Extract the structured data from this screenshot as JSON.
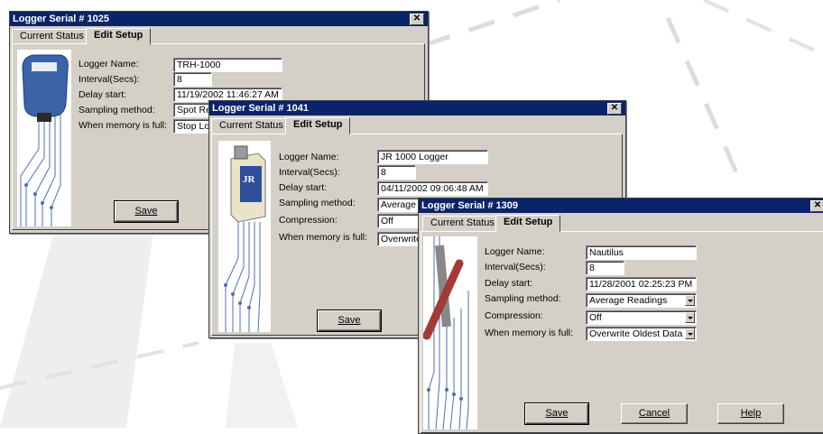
{
  "windows": [
    {
      "title": "Logger Serial # 1025",
      "tabs": [
        "Current Status",
        "Edit Setup"
      ],
      "labels": {
        "name": "Logger Name:",
        "interval": "Interval(Secs):",
        "delay": "Delay start:",
        "sampling": "Sampling method:",
        "memory": "When memory is full:"
      },
      "values": {
        "name": "TRH-1000",
        "interval": "8",
        "delay": "11/19/2002 11:46:27 AM",
        "sampling": "Spot Readings",
        "memory": "Stop Logging"
      },
      "buttons": {
        "save": "Save"
      }
    },
    {
      "title": "Logger Serial # 1041",
      "tabs": [
        "Current Status",
        "Edit Setup"
      ],
      "labels": {
        "name": "Logger Name:",
        "interval": "Interval(Secs):",
        "delay": "Delay start:",
        "sampling": "Sampling method:",
        "compression": "Compression:",
        "memory": "When memory is full:"
      },
      "values": {
        "name": "JR 1000 Logger",
        "interval": "8",
        "delay": "04/11/2002 09:06:48 AM",
        "sampling": "Average Readings",
        "compression": "Off",
        "memory": "Overwrite Oldest Data"
      },
      "buttons": {
        "save": "Save"
      }
    },
    {
      "title": "Logger Serial # 1309",
      "tabs": [
        "Current Status",
        "Edit Setup"
      ],
      "labels": {
        "name": "Logger Name:",
        "interval": "Interval(Secs):",
        "delay": "Delay start:",
        "sampling": "Sampling method:",
        "compression": "Compression:",
        "memory": "When memory is full:"
      },
      "values": {
        "name": "Nautilus",
        "interval": "8",
        "delay": "11/28/2001 02:25:23 PM",
        "sampling": "Average Readings",
        "compression": "Off",
        "memory": "Overwrite Oldest Data"
      },
      "buttons": {
        "save": "Save",
        "cancel": "Cancel",
        "help": "Help"
      }
    }
  ],
  "close_glyph": "✕",
  "colors": {
    "titlebar": "#0a246a",
    "dialog": "#d4d0c8",
    "circuit": "#4b6fb5"
  }
}
